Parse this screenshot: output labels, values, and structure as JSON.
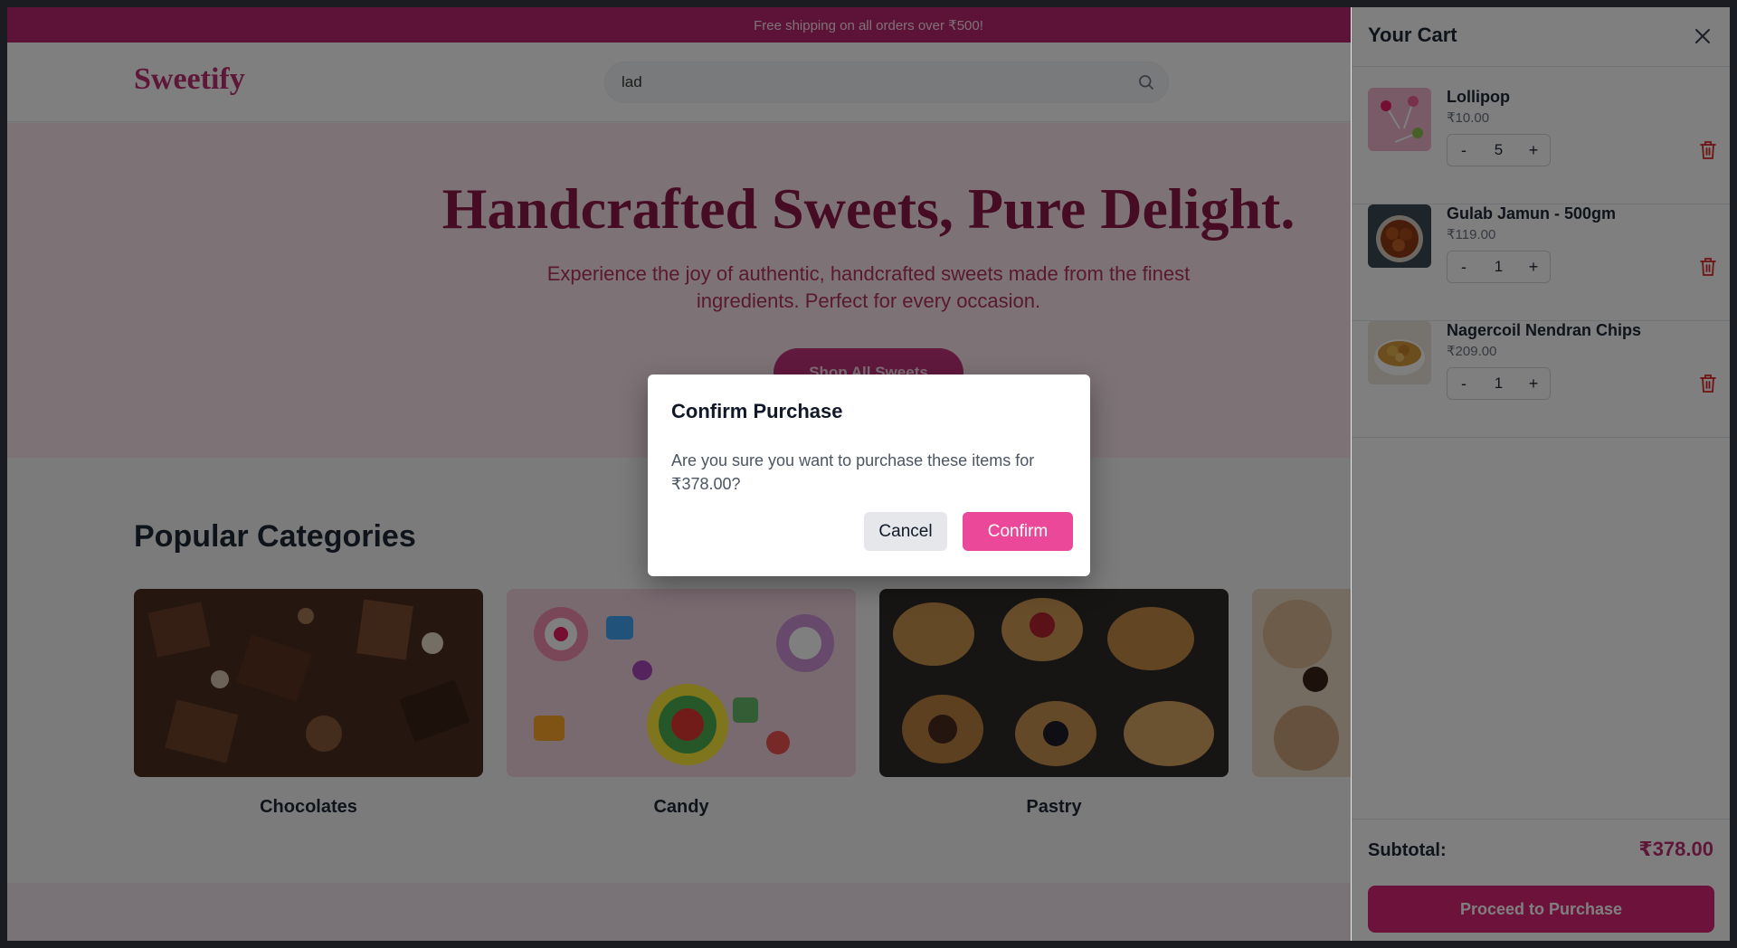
{
  "promo_bar": {
    "text": "Free shipping on all orders over ₹500!"
  },
  "header": {
    "logo": "Sweetify",
    "search": {
      "value": "lad",
      "placeholder": ""
    }
  },
  "hero": {
    "title": "Handcrafted Sweets, Pure Delight.",
    "subtitle": "Experience the joy of authentic, handcrafted sweets made from the finest ingredients. Perfect for every occasion.",
    "cta_label": "Shop All Sweets"
  },
  "categories": {
    "heading": "Popular Categories",
    "items": [
      {
        "label": "Chocolates"
      },
      {
        "label": "Candy"
      },
      {
        "label": "Pastry"
      },
      {
        "label": ""
      }
    ]
  },
  "cart": {
    "title": "Your Cart",
    "items": [
      {
        "name": "Lollipop",
        "price": "₹10.00",
        "quantity": "5",
        "minus": "-",
        "plus": "+"
      },
      {
        "name": "Gulab Jamun - 500gm",
        "price": "₹119.00",
        "quantity": "1",
        "minus": "-",
        "plus": "+"
      },
      {
        "name": "Nagercoil Nendran Chips",
        "price": "₹209.00",
        "quantity": "1",
        "minus": "-",
        "plus": "+"
      }
    ],
    "subtotal_label": "Subtotal:",
    "subtotal_value": "₹378.00",
    "proceed_label": "Proceed to Purchase"
  },
  "modal": {
    "title": "Confirm Purchase",
    "message": "Are you sure you want to purchase these items for ₹378.00?",
    "cancel_label": "Cancel",
    "confirm_label": "Confirm"
  },
  "colors": {
    "brand": "#be2f73",
    "hero_bg": "#fbe6ee",
    "confirm_button": "#ec4899",
    "proceed_button": "#db2777",
    "delete_icon": "#dc2626"
  }
}
